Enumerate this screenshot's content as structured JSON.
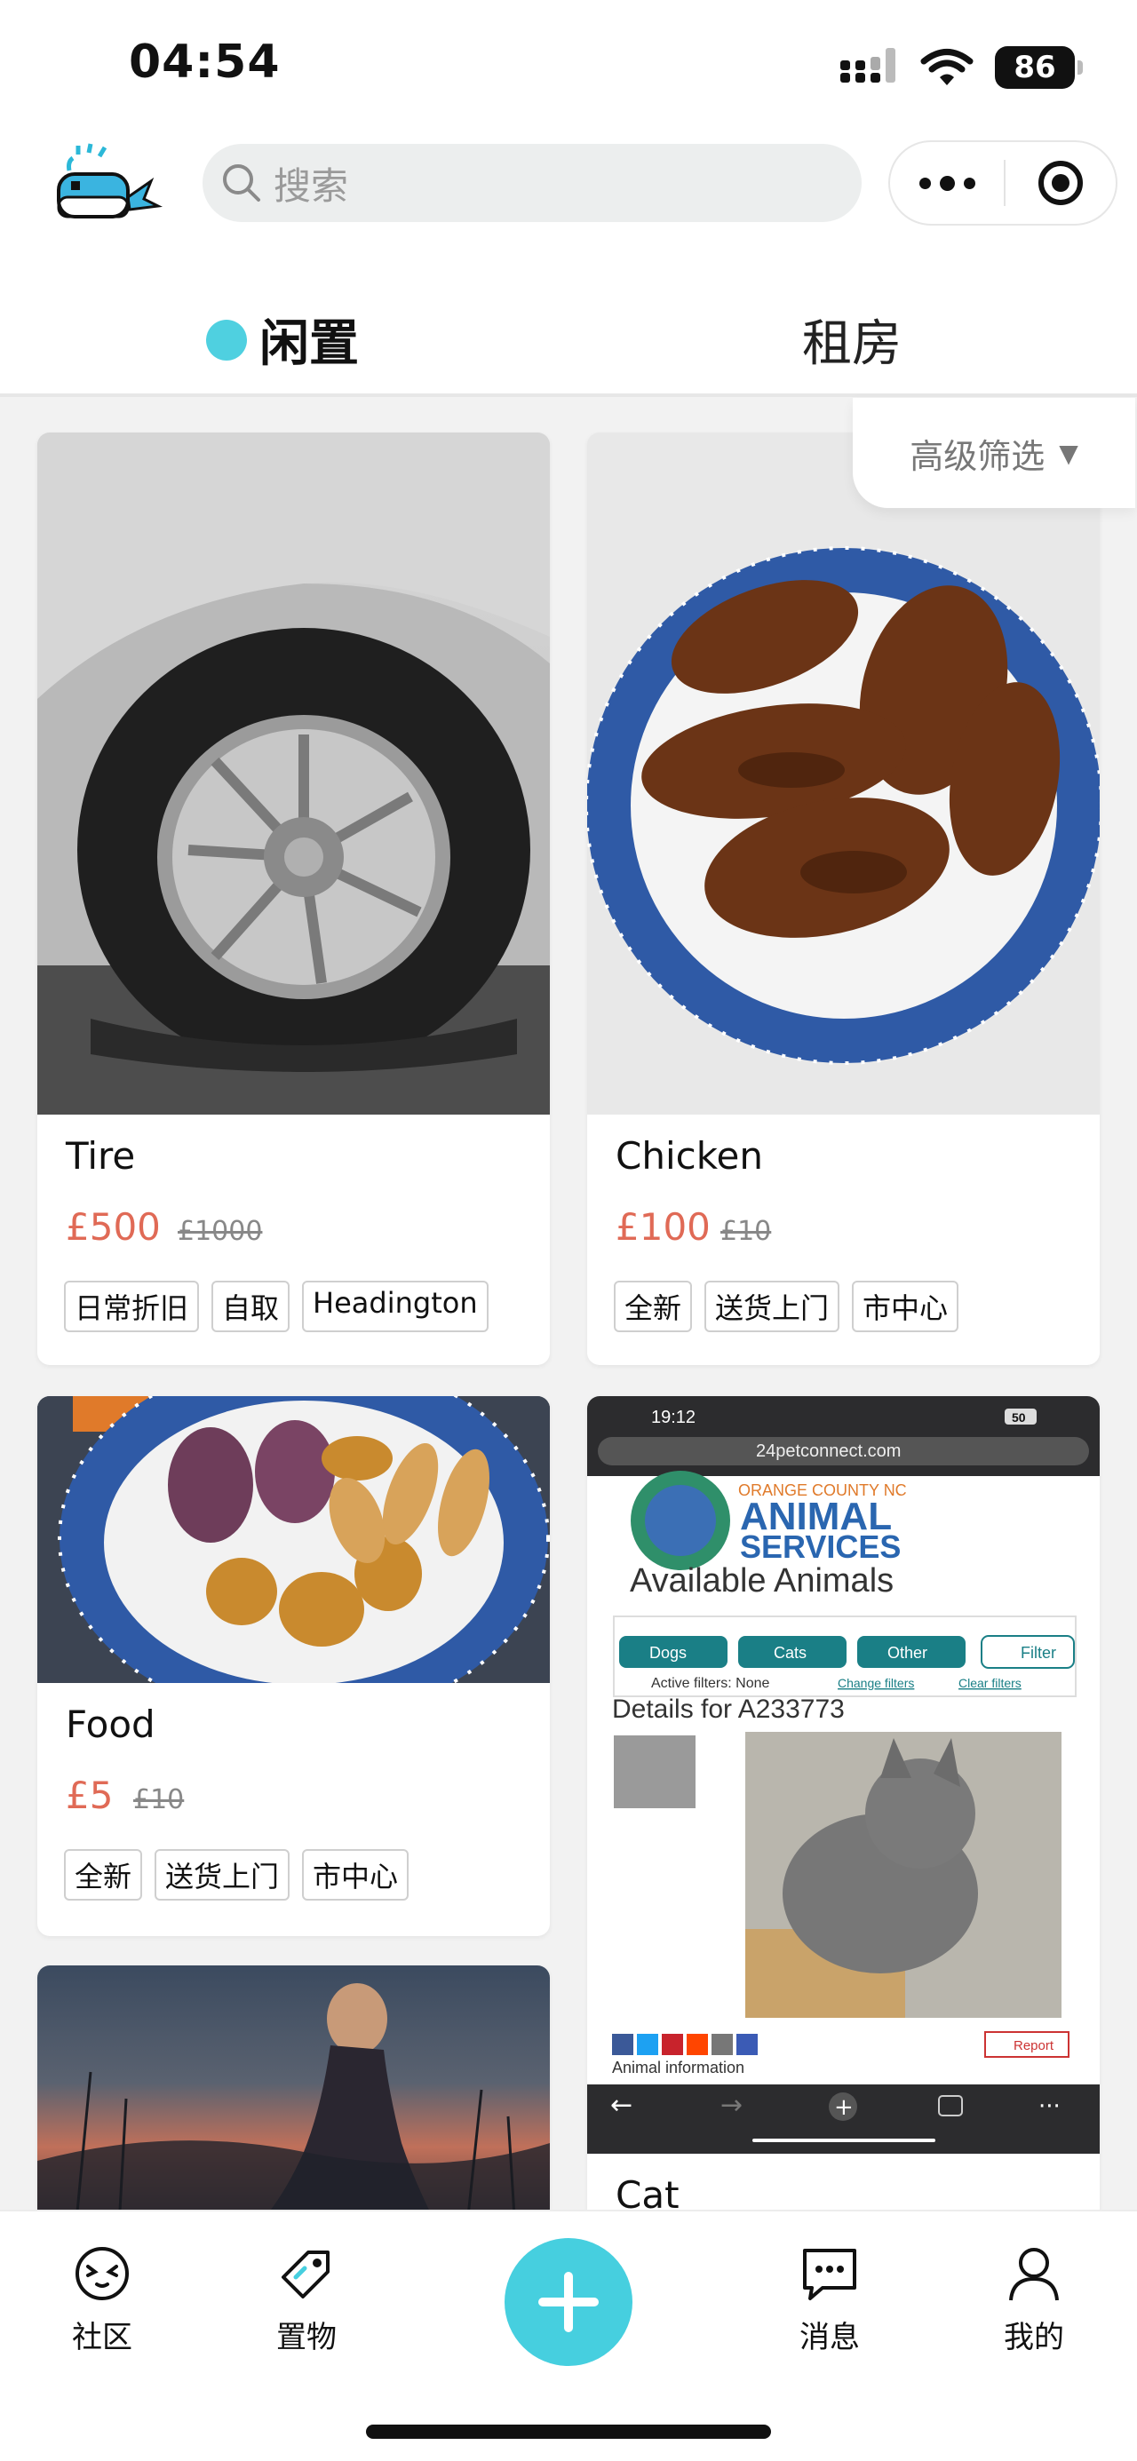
{
  "status_bar": {
    "time": "04:54",
    "battery": "86"
  },
  "search": {
    "placeholder": "搜索"
  },
  "tabs": [
    {
      "label": "闲置",
      "active": true
    },
    {
      "label": "租房",
      "active": false
    }
  ],
  "filter": {
    "label": "高级筛选",
    "arrow": "▼"
  },
  "listings": [
    {
      "title": "Tire",
      "price": "£500",
      "original_price": "£1000",
      "tags": [
        "日常折旧",
        "自取",
        "Headington"
      ]
    },
    {
      "title": "Chicken",
      "price": "£100",
      "original_price": "£10",
      "tags": [
        "全新",
        "送货上门",
        "市中心"
      ]
    },
    {
      "title": "Food",
      "price": "£5",
      "original_price": "£10",
      "tags": [
        "全新",
        "送货上门",
        "市中心"
      ]
    },
    {
      "title": "Cat"
    }
  ],
  "cat_screenshot": {
    "time": "19:12",
    "battery": "50",
    "url": "24petconnect.com",
    "org_line": "ORANGE COUNTY NC",
    "org_name_1": "ANIMAL",
    "org_name_2": "SERVICES",
    "heading": "Available Animals",
    "filters": [
      "Dogs",
      "Cats",
      "Other"
    ],
    "filter_button": "Filter",
    "active_filters": "Active filters: None",
    "change_filters": "Change filters",
    "clear_filters": "Clear filters",
    "details": "Details for A233773",
    "report": "Report",
    "animal_info": "Animal information"
  },
  "bottom_nav": [
    {
      "label": "社区"
    },
    {
      "label": "置物"
    },
    {
      "label": "消息"
    },
    {
      "label": "我的"
    }
  ],
  "colors": {
    "accent": "#46cfdf",
    "price": "#e06a56"
  }
}
